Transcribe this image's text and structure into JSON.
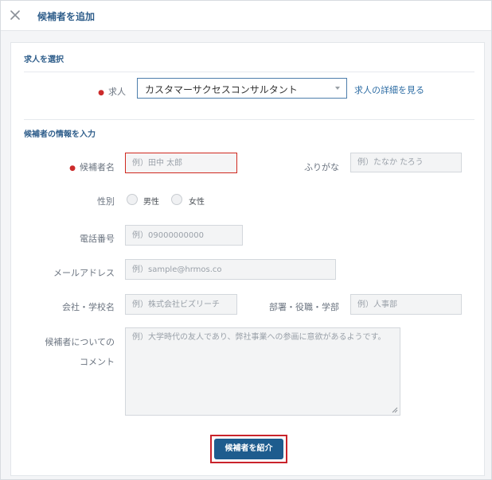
{
  "header": {
    "title": "候補者を追加",
    "close_icon": "close-icon"
  },
  "job_section": {
    "title": "求人を選択",
    "job_label": "求人",
    "job_selected": "カスタマーサクセスコンサルタント",
    "details_link": "求人の詳細を見る"
  },
  "candidate_section": {
    "title": "候補者の情報を入力",
    "name_label": "候補者名",
    "name_placeholder": "例）田中 太郎",
    "furigana_label": "ふりがな",
    "furigana_placeholder": "例）たなか たろう",
    "gender_label": "性別",
    "gender_options": [
      "男性",
      "女性"
    ],
    "phone_label": "電話番号",
    "phone_placeholder": "例）09000000000",
    "email_label": "メールアドレス",
    "email_placeholder": "例）sample@hrmos.co",
    "company_label": "会社・学校名",
    "company_placeholder": "例）株式会社ビズリーチ",
    "department_label": "部署・役職・学部",
    "department_placeholder": "例）人事部",
    "comment_label_line1": "候補者についての",
    "comment_label_line2": "コメント",
    "comment_placeholder": "例）大学時代の友人であり、弊社事業への参画に意欲があるようです。"
  },
  "submit_label": "候補者を紹介",
  "colors": {
    "accent": "#1e5c8e",
    "title_blue": "#2f5e8b",
    "required_red": "#cc2b2b",
    "highlight_red": "#c9232b"
  }
}
